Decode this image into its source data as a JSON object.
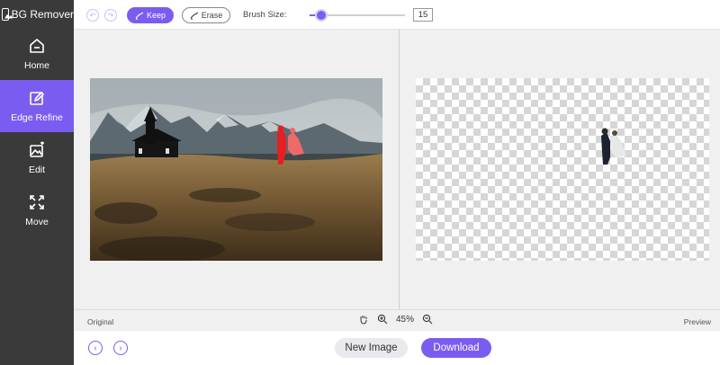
{
  "app": {
    "title": "BG Remover"
  },
  "sidebar": {
    "items": [
      {
        "label": "Home",
        "icon": "home-icon",
        "active": false
      },
      {
        "label": "Edge Refine",
        "icon": "edit-pencil-icon",
        "active": true
      },
      {
        "label": "Edit",
        "icon": "image-edit-icon",
        "active": false
      },
      {
        "label": "Move",
        "icon": "move-arrows-icon",
        "active": false
      }
    ]
  },
  "toolbar": {
    "keep_label": "Keep",
    "erase_label": "Erase",
    "brush_size_label": "Brush Size:",
    "brush_size_value": "15",
    "brush_slider_fraction": 0.12
  },
  "status": {
    "original_label": "Original",
    "preview_label": "Preview",
    "zoom": "45%"
  },
  "footer": {
    "new_image_label": "New Image",
    "download_label": "Download"
  },
  "colors": {
    "accent": "#7b5cf0",
    "sidebar_bg": "#3a3a3a"
  }
}
